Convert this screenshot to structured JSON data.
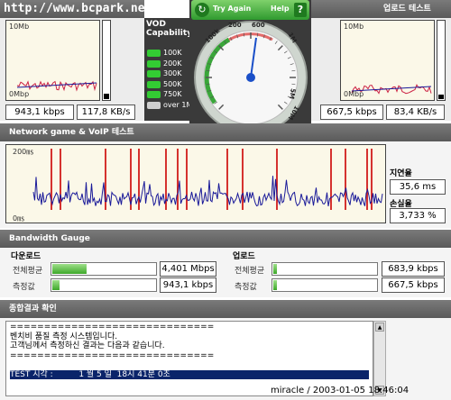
{
  "watermark": "http://www.bcpark.net",
  "upload_title": "업로드 테스트",
  "vod": {
    "title": "VOD Capability",
    "items": [
      {
        "label": "100K",
        "on": true
      },
      {
        "label": "200K",
        "on": true
      },
      {
        "label": "300K",
        "on": true
      },
      {
        "label": "500K",
        "on": true
      },
      {
        "label": "750K",
        "on": true
      },
      {
        "label": "over 1M",
        "on": false
      }
    ]
  },
  "gauge": {
    "try_again": "Try Again",
    "help": "Help",
    "help_q": "?",
    "scale": [
      "100k",
      "200",
      "600",
      "1M",
      "5M",
      "10M"
    ],
    "needle_value_kbps": 943.1
  },
  "download_chart": {
    "ymax_label": "10Mb",
    "ymin_label": "0Mbp",
    "speed": "943,1 kbps",
    "rate": "117,8 KB/s"
  },
  "upload_chart": {
    "ymax_label": "10Mb",
    "ymin_label": "0Mbp",
    "speed": "667,5 kbps",
    "rate": "83,4 KB/s"
  },
  "network": {
    "title": "Network game & VoIP 테스트",
    "ymax_label": "200㎳",
    "ymin_label": "0㎳",
    "latency_label": "지연율",
    "latency_value": "35,6 ms",
    "loss_label": "손실율",
    "loss_value": "3,733 %"
  },
  "bandwidth": {
    "title": "Bandwidth Gauge",
    "download": {
      "title": "다운로드",
      "avg_label": "전체평균",
      "avg_value": "4,401 Mbps",
      "avg_fraction": 0.33,
      "meas_label": "측정값",
      "meas_value": "943,1 kbps",
      "meas_fraction": 0.07
    },
    "upload": {
      "title": "업로드",
      "avg_label": "전체평균",
      "avg_value": "683,9 kbps",
      "avg_fraction": 0.02,
      "meas_label": "측정값",
      "meas_value": "667,5 kbps",
      "meas_fraction": 0.02
    }
  },
  "summary": {
    "title": "종합결과 확인",
    "lines": [
      "==============================",
      "벤치비 품질 측정 시스템입니다.",
      "고객님께서 측정하신 결과는 다음과 같습니다.",
      "==============================",
      "",
      "TEST 시각 :          1 월 5 일  18시 41분 0초"
    ]
  },
  "footer_stamp": "miracle / 2003-01-05 18:46:04",
  "colors": {
    "header": "#666666",
    "gauge_green": "#3aa63a",
    "vod_on": "#33cc33",
    "vod_off": "#cfcfcf",
    "spike_red": "#cc0000",
    "trace_blue": "#1a1a99"
  }
}
